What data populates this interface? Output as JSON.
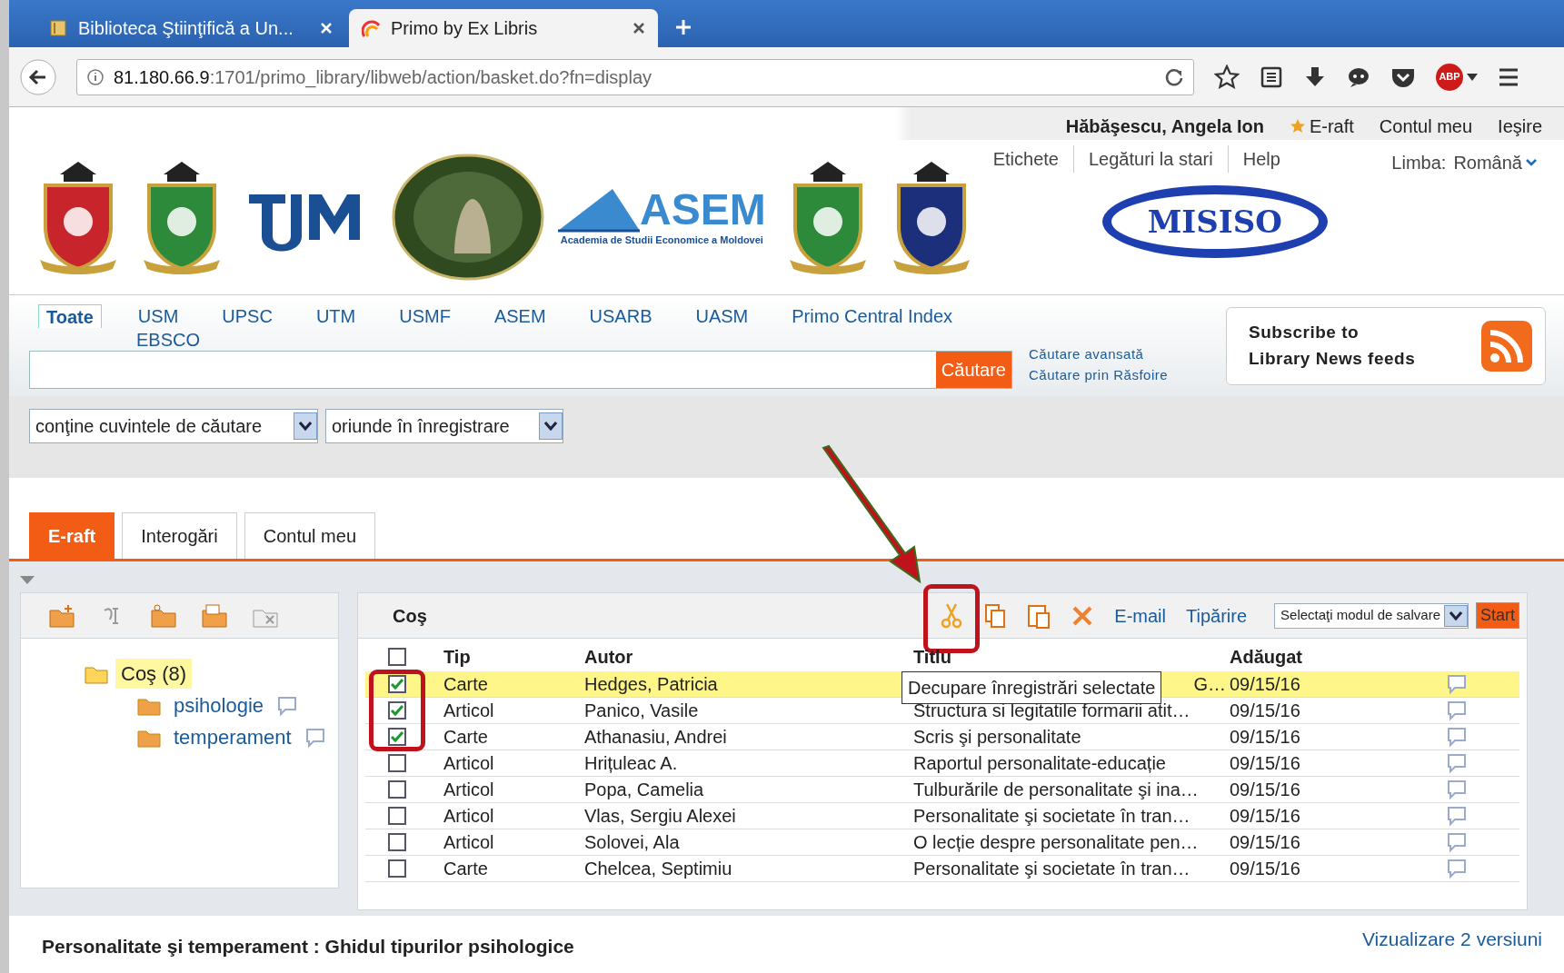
{
  "browser": {
    "tabs": [
      {
        "label": "Biblioteca Ştiinţifică a Un...",
        "selected": false
      },
      {
        "label": "Primo by Ex Libris",
        "selected": true
      }
    ],
    "url_host": "81.180.66.9",
    "url_rest": ":1701/primo_library/libweb/action/basket.do?fn=display",
    "abp": "ABP"
  },
  "user_bar": {
    "user": "Hăbăşescu, Angela Ion",
    "links": [
      "E-raft",
      "Contul meu",
      "Ieşire"
    ]
  },
  "header": {
    "links": [
      "Etichete",
      "Legături la stari",
      "Help"
    ],
    "language_label": "Limba:",
    "language": "Română",
    "asem_logo": "ASEM",
    "asem_caption": "Academia de Studii Economice a Moldovei",
    "misiso_logo": "MISISO"
  },
  "search": {
    "scopes": [
      {
        "label": "Toate",
        "selected": true
      },
      {
        "label": "USM",
        "selected": false
      },
      {
        "label": "UPSC",
        "selected": false
      },
      {
        "label": "UTM",
        "selected": false
      },
      {
        "label": "USMF",
        "selected": false
      },
      {
        "label": "ASEM",
        "selected": false
      },
      {
        "label": "USARB",
        "selected": false
      },
      {
        "label": "UASM",
        "selected": false
      },
      {
        "label": "Primo Central Index",
        "selected": false
      },
      {
        "label": "EBSCO",
        "selected": false
      }
    ],
    "button": "Căutare",
    "links": [
      "Căutare avansată",
      "Căutare prin Răsfoire"
    ],
    "rss": [
      "Subscribe to",
      "Library News feeds"
    ],
    "filters": [
      "conţine cuvintele de căutare",
      "oriunde în înregistrare"
    ]
  },
  "tabs": [
    {
      "label": "E-raft",
      "selected": true
    },
    {
      "label": "Interogări",
      "selected": false
    },
    {
      "label": "Contul meu",
      "selected": false
    }
  ],
  "folders": [
    {
      "label": "Coş (8)",
      "selected": true,
      "children": [
        {
          "label": "psihologie",
          "selected": false
        },
        {
          "label": "temperament",
          "selected": false
        }
      ]
    }
  ],
  "basket": {
    "title": "Coş",
    "actions": [
      "E-mail",
      "Tipărire"
    ],
    "save_select": "Selectaţi modul de salvare",
    "start": "Start",
    "tooltip": "Decupare înregistrări selectate",
    "all_checked": false,
    "columns": [
      "Tip",
      "Autor",
      "Titlu",
      "Adăugat"
    ],
    "rows": [
      {
        "checked": true,
        "selected": true,
        "tip": "Carte",
        "autor": "Hedges, Patricia",
        "titlu": "G…",
        "adaugat": "09/15/16"
      },
      {
        "checked": true,
        "selected": false,
        "tip": "Articol",
        "autor": "Panico, Vasile",
        "titlu": "Structura si legitatile formarii atit…",
        "adaugat": "09/15/16"
      },
      {
        "checked": true,
        "selected": false,
        "tip": "Carte",
        "autor": "Athanasiu, Andrei",
        "titlu": "Scris şi personalitate",
        "adaugat": "09/15/16"
      },
      {
        "checked": false,
        "selected": false,
        "tip": "Articol",
        "autor": "Hrițuleac A.",
        "titlu": "Raportul personalitate-educație",
        "adaugat": "09/15/16"
      },
      {
        "checked": false,
        "selected": false,
        "tip": "Articol",
        "autor": "Popa, Camelia",
        "titlu": "Tulburările de personalitate şi ina…",
        "adaugat": "09/15/16"
      },
      {
        "checked": false,
        "selected": false,
        "tip": "Articol",
        "autor": "Vlas, Sergiu Alexei",
        "titlu": "Personalitate şi societate în tran…",
        "adaugat": "09/15/16"
      },
      {
        "checked": false,
        "selected": false,
        "tip": "Articol",
        "autor": "Solovei, Ala",
        "titlu": "O lecție despre personalitate pen…",
        "adaugat": "09/15/16"
      },
      {
        "checked": false,
        "selected": false,
        "tip": "Carte",
        "autor": "Chelcea, Septimiu",
        "titlu": "Personalitate şi societate în tran…",
        "adaugat": "09/15/16"
      }
    ]
  },
  "details": {
    "title": "Personalitate şi temperament : Ghidul tipurilor psihologice",
    "versions": "Vizualizare 2 versiuni"
  }
}
